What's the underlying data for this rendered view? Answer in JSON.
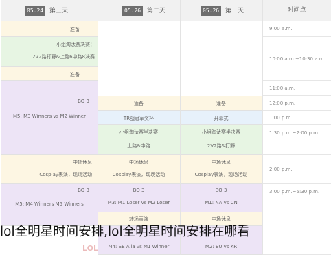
{
  "colors": {
    "yellow": "#fdf6e3",
    "green": "#e7f5e3",
    "purple": "#ede4f6",
    "blue": "#e7f1fb",
    "white": "#ffffff"
  },
  "header": {
    "time_label": "时间点",
    "days": [
      {
        "label": "第三天",
        "date": "05.24"
      },
      {
        "label": "第二天",
        "date": "05.26"
      },
      {
        "label": "第一天",
        "date": "05.26"
      }
    ]
  },
  "times": [
    "9:00 a.m.",
    "10:00 a.m.~10:30 a.m.",
    "11:00 a.m.",
    "12:00 p.m.",
    "1:00 p.m.",
    "1:30 p.m.~2:00 p.m.",
    "2:00 p.m.",
    "3:00 p.m.~5:30 p.m."
  ],
  "day3": {
    "c1": "准备",
    "c2a": "小组淘汰赛决赛：",
    "c2b": "2V2路打野&上路6中路8决赛",
    "c3": "准备",
    "c4a": "BO 3",
    "c4b": "M5: M3 Winners vs M2 Winner",
    "c5a": "中场休息",
    "c5b": "Cosplay表演，现场活动",
    "c6a": "BO 3",
    "c6b": "M5: M4 Winners M5 Winners"
  },
  "day2": {
    "c1": "准备",
    "c2": "TR战冠军奖杯",
    "c3a": "小组淘汰赛半决赛",
    "c3b": "上路&中路",
    "c4a": "中场休息",
    "c4b": "Cosplay表演，现场活动",
    "c5a": "BO 3",
    "c5b": "M3: M1 Loser vs M2 Loser",
    "c6": "转场表演",
    "c7": "M4: SE Alia vs M1 Winner"
  },
  "day1": {
    "c1": "准备",
    "c2": "开幕式",
    "c3a": "小组淘汰赛半决赛",
    "c3b": "2V2路&打野",
    "c4a": "中场休息",
    "c4b": "Cosplay表演，现场活动",
    "c5a": "BO 3",
    "c5b": "M1: NA vs CN",
    "c6": "中场休息",
    "c7": "M2: EU vs KR"
  },
  "watermark": "LOL",
  "caption": "lol全明星时间安排,lol全明星时间安排在哪看"
}
